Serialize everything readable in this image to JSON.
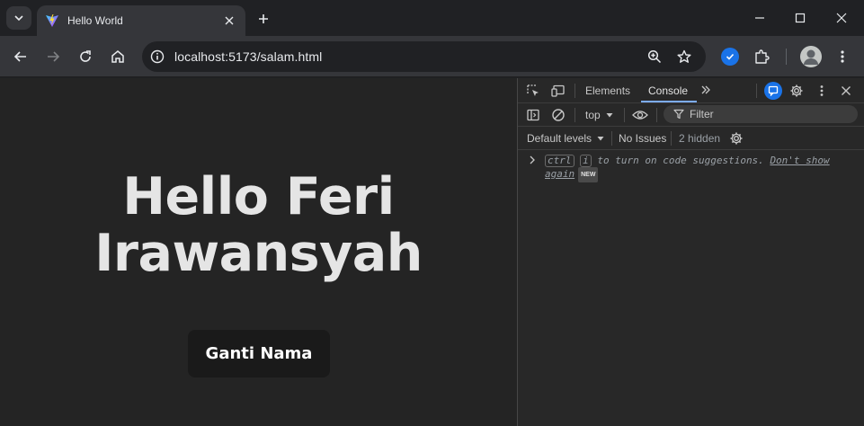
{
  "browser": {
    "tab_title": "Hello World",
    "url": "localhost:5173/salam.html"
  },
  "page": {
    "heading": "Hello Feri Irawansyah",
    "button_label": "Ganti Nama"
  },
  "devtools": {
    "tabs": [
      "Elements",
      "Console"
    ],
    "active_tab": "Console",
    "context": "top",
    "filter_placeholder": "Filter",
    "levels_label": "Default levels",
    "issues_label": "No Issues",
    "hidden_label": "2 hidden",
    "suggestion": {
      "key1": "ctrl",
      "key2": "i",
      "text": "to turn on code suggestions.",
      "link": "Don't show again",
      "badge": "NEW"
    }
  },
  "colors": {
    "page_background": "#242424",
    "heading": "#e5e5e5",
    "button_background": "#1a1a1a",
    "accent": "#1a73e8"
  }
}
